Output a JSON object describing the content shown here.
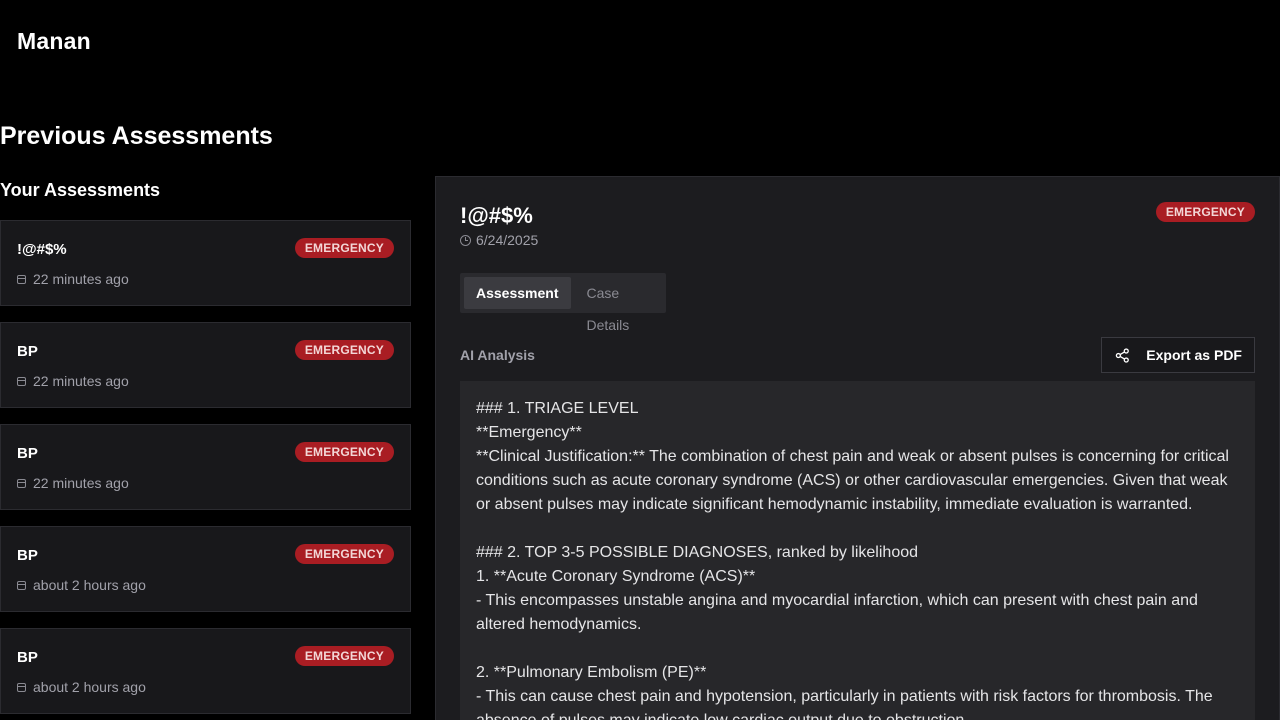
{
  "brand": "Manan",
  "page_title": "Previous Assessments",
  "list_title": "Your Assessments",
  "colors": {
    "accent_selected": "#8b5cf6",
    "emergency_badge": "#a91d23",
    "background": "#000000"
  },
  "assessments": [
    {
      "title": "!@#$%",
      "badge": "EMERGENCY",
      "time": "22 minutes ago",
      "selected": true
    },
    {
      "title": "BP",
      "badge": "EMERGENCY",
      "time": "22 minutes ago",
      "selected": false
    },
    {
      "title": "BP",
      "badge": "EMERGENCY",
      "time": "22 minutes ago",
      "selected": false
    },
    {
      "title": "BP",
      "badge": "EMERGENCY",
      "time": "about 2 hours ago",
      "selected": false
    },
    {
      "title": "BP",
      "badge": "EMERGENCY",
      "time": "about 2 hours ago",
      "selected": false
    }
  ],
  "detail": {
    "title": "!@#$%",
    "badge": "EMERGENCY",
    "date": "6/24/2025",
    "tabs": [
      "Assessment",
      "Case Details"
    ],
    "active_tab": "Assessment",
    "section_label": "AI Analysis",
    "export_label": "Export as PDF",
    "icons": {
      "date": "clock-icon",
      "export": "share-icon",
      "list_time": "calendar-icon"
    },
    "analysis_lines": [
      "### 1. TRIAGE LEVEL",
      "**Emergency**",
      "**Clinical Justification:** The combination of chest pain and weak or absent pulses is concerning for critical conditions such as acute coronary syndrome (ACS) or other cardiovascular emergencies. Given that weak or absent pulses may indicate significant hemodynamic instability, immediate evaluation is warranted.",
      "",
      "### 2. TOP 3-5 POSSIBLE DIAGNOSES, ranked by likelihood",
      "1. **Acute Coronary Syndrome (ACS)**",
      "   - This encompasses unstable angina and myocardial infarction, which can present with chest pain and altered hemodynamics.",
      "",
      "2. **Pulmonary Embolism (PE)**",
      "   - This can cause chest pain and hypotension, particularly in patients with risk factors for thrombosis. The absence of pulses may indicate low cardiac output due to obstruction."
    ]
  }
}
